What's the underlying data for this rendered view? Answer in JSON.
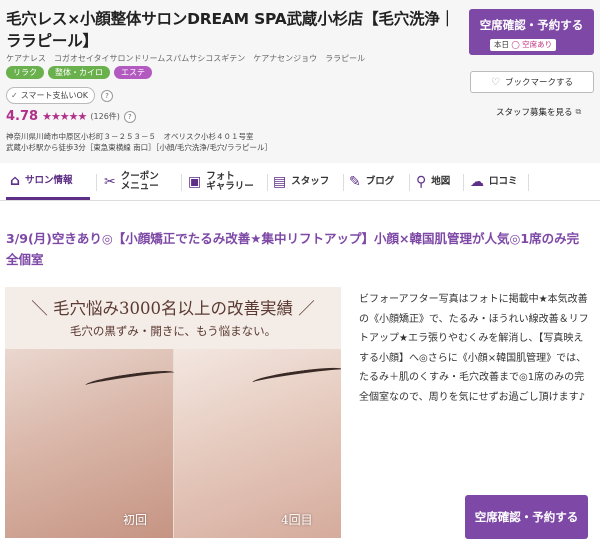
{
  "salon": {
    "title": "毛穴レス×小顔整体サロンDREAM SPA武蔵小杉店【毛穴洗浄｜ララピール】",
    "kana": "ケアナレス　コガオセイタイサロンドリームスパムサシコスギテン　ケアナセンジョウ　ララピール",
    "tags": [
      "リラク",
      "整体・カイロ",
      "エステ"
    ],
    "payment_badge": "スマート支払いOK",
    "help_mark": "?",
    "rating": "4.78",
    "stars": "★★★★★",
    "review_count": "(126件)",
    "address_line1": "神奈川県川崎市中原区小杉町３－２５３－５　オベリスク小杉４０１号室",
    "address_line2": "武蔵小杉駅から徒歩3分［東急東横線 南口］［小顔/毛穴洗浄/毛穴/ララピール］"
  },
  "actions": {
    "reserve_label": "空席確認・予約する",
    "vacancy_prefix": "本日",
    "vacancy_status": "◯ 空席あり",
    "bookmark_label": "ブックマークする",
    "staff_recruit_label": "スタッフ募集を見る"
  },
  "nav": {
    "tabs": [
      {
        "label": "サロン情報"
      },
      {
        "label": "クーポン\nメニュー"
      },
      {
        "label": "フォト\nギャラリー"
      },
      {
        "label": "スタッフ"
      },
      {
        "label": "ブログ"
      },
      {
        "label": "地図"
      },
      {
        "label": "口コミ"
      }
    ]
  },
  "main": {
    "catch_copy": "3/9(月)空きあり◎【小顔矯正でたるみ改善★集中リフトアップ】小顔×韓国肌管理が人気◎1席のみ完全個室",
    "photo_headline": "＼ 毛穴悩み3000名以上の改善実績 ／",
    "photo_subline": "毛穴の黒ずみ・開きに、もう悩まない。",
    "photo_before": "初回",
    "photo_after": "4回目",
    "description": "ビフォーアフター写真はフォトに掲載中★本気改善の《小顔矯正》で、たるみ・ほうれい線改善＆リフトアップ★エラ張りやむくみを解消し、【写真映えする小顔】へ◎さらに《小顔×韓国肌管理》では、たるみ＋肌のくすみ・毛穴改善まで◎1席のみの完全個室なので、周りを気にせずお過ごし頂けます♪",
    "reserve_label": "空席確認・予約する"
  }
}
